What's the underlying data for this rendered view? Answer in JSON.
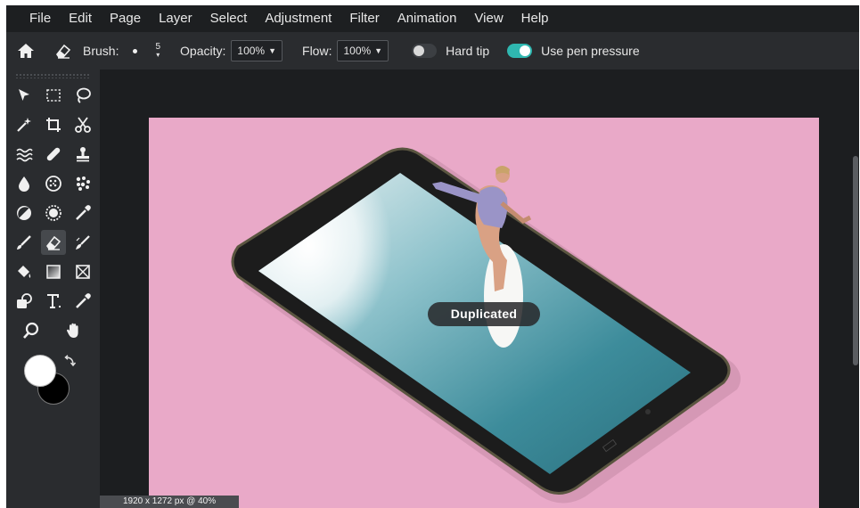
{
  "menu": [
    "File",
    "Edit",
    "Page",
    "Layer",
    "Select",
    "Adjustment",
    "Filter",
    "Animation",
    "View",
    "Help"
  ],
  "toolbar": {
    "brush_label": "Brush:",
    "brush_size": "5",
    "opacity_label": "Opacity:",
    "opacity_value": "100%",
    "flow_label": "Flow:",
    "flow_value": "100%",
    "hard_tip_label": "Hard tip",
    "hard_tip_on": false,
    "pen_pressure_label": "Use pen pressure",
    "pen_pressure_on": true
  },
  "tools": [
    "move-tool",
    "marquee-tool",
    "lasso-tool",
    "magic-wand-tool",
    "crop-tool",
    "scissors-tool",
    "liquify-tool",
    "healing-tool",
    "clone-stamp-tool",
    "blur-tool",
    "sponge-tool",
    "pattern-tool",
    "dodge-tool",
    "burn-tool",
    "color-picker-tool",
    "brush-tool",
    "eraser-tool",
    "smudge-tool",
    "fill-tool",
    "gradient-tool",
    "shape-tool",
    "paint-shape-tool",
    "text-tool",
    "eyedropper-tool",
    "zoom-tool",
    "hand-tool"
  ],
  "active_tool": "eraser-tool",
  "colors": {
    "foreground": "#ffffff",
    "background": "#000000",
    "accent": "#2fb7b0",
    "canvas_bg": "#e9a9c8"
  },
  "toast": "Duplicated",
  "status": "1920 x 1272 px @ 40%"
}
